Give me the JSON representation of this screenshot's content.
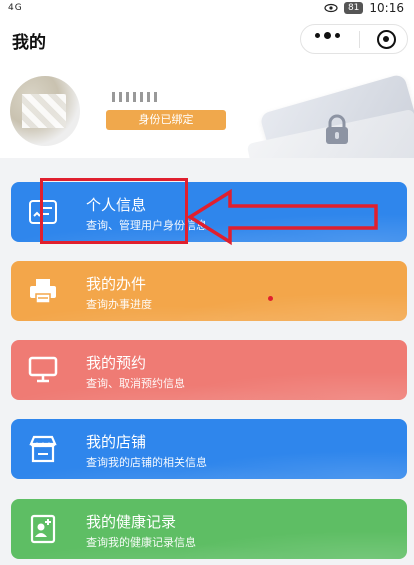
{
  "status_bar": {
    "signal": "4G",
    "battery": "81",
    "time": "10:16"
  },
  "header": {
    "title": "我的"
  },
  "profile": {
    "bind_status": "身份已绑定"
  },
  "menu": [
    {
      "title": "个人信息",
      "subtitle": "查询、管理用户身份信息",
      "icon": "id-card-icon"
    },
    {
      "title": "我的办件",
      "subtitle": "查询办事进度",
      "icon": "printer-icon"
    },
    {
      "title": "我的预约",
      "subtitle": "查询、取消预约信息",
      "icon": "monitor-icon"
    },
    {
      "title": "我的店铺",
      "subtitle": "查询我的店铺的相关信息",
      "icon": "store-icon"
    },
    {
      "title": "我的健康记录",
      "subtitle": "查询我的健康记录信息",
      "icon": "health-record-icon"
    }
  ],
  "colors": {
    "blue": "#2f86ec",
    "orange": "#f3a64a",
    "coral": "#ef7b74",
    "green": "#5ebe64",
    "annotation_red": "#e01f2e"
  }
}
